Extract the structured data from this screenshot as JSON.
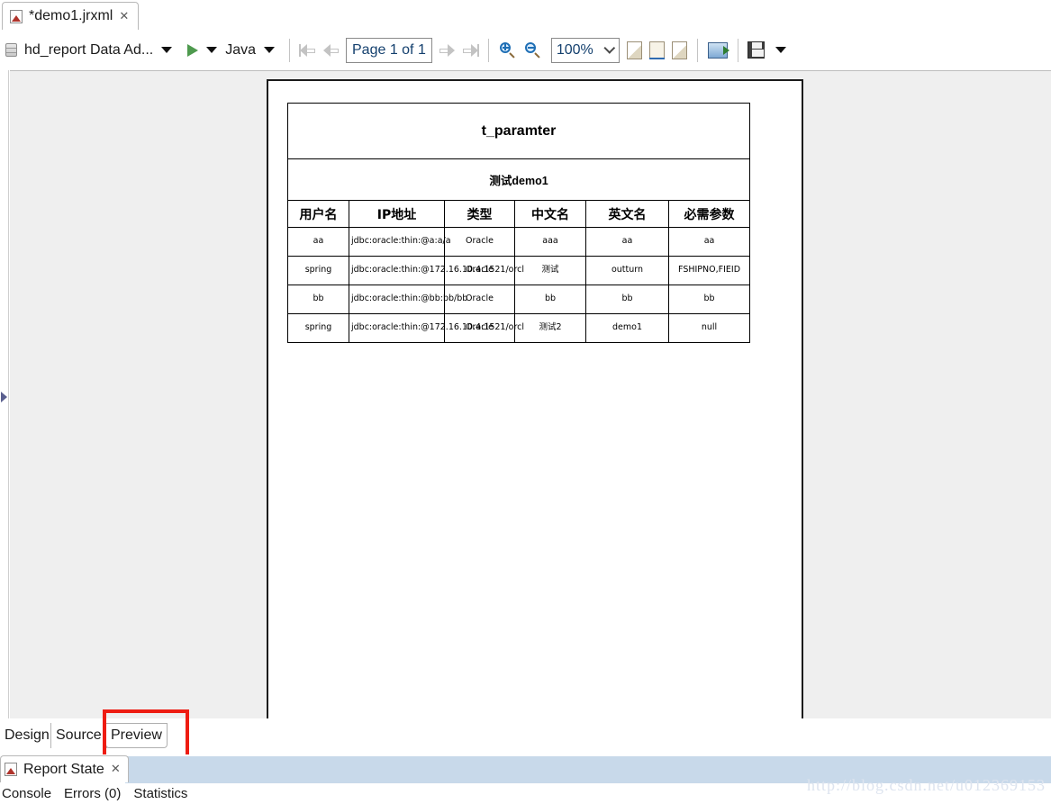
{
  "editor_tab": {
    "title": "*demo1.jrxml",
    "close_label": "✕",
    "icon": "jasper-report-file-icon"
  },
  "toolbar": {
    "datasource_label": "hd_report Data Ad...",
    "datasource_icon": "database-icon",
    "datasource_caret": "▼",
    "run_icon": "run-play-icon",
    "run_caret": "▼",
    "language_label": "Java",
    "language_caret": "▼",
    "nav_first": "first-page-icon",
    "nav_prev": "previous-page-icon",
    "page_field_value": "Page 1 of 1",
    "nav_next": "next-page-icon",
    "nav_last": "last-page-icon",
    "zoom_in_icon": "zoom-in-icon",
    "zoom_out_icon": "zoom-out-icon",
    "zoom_value": "100%",
    "zoom_chevron": "chevron-down-icon",
    "fit_page_icon": "fit-page-icon",
    "fit_width_icon": "fit-width-icon",
    "actual_size_icon": "actual-size-icon",
    "export_icon": "export-icon",
    "save_icon": "save-icon",
    "save_caret": "▼"
  },
  "report": {
    "title": "t_paramter",
    "subtitle": "测试demo1",
    "columns": [
      "用户名",
      "IP地址",
      "类型",
      "中文名",
      "英文名",
      "必需参数"
    ],
    "rows": [
      [
        "aa",
        "jdbc:oracle:thin:@a:a/a",
        "Oracle",
        "aaa",
        "aa",
        "aa"
      ],
      [
        "spring",
        "jdbc:oracle:thin:@172.16.10.4:1521/orcl",
        "Oracle",
        "测试",
        "outturn",
        "FSHIPNO,FIEID"
      ],
      [
        "bb",
        "jdbc:oracle:thin:@bb:bb/bb",
        "Oracle",
        "bb",
        "bb",
        "bb"
      ],
      [
        "spring",
        "jdbc:oracle:thin:@172.16.10.4:1521/orcl",
        "Oracle",
        "测试2",
        "demo1",
        "null"
      ]
    ]
  },
  "editor_bottom_tabs": {
    "design": "Design",
    "source": "Source",
    "preview": "Preview",
    "highlight_color": "#ee1c12"
  },
  "view_tab": {
    "title": "Report State",
    "close_label": "✕",
    "icon": "jasper-report-state-icon",
    "strip_color": "#c8d9ea"
  },
  "bottom_bar": {
    "console": "Console",
    "errors": "Errors (0)",
    "statistics": "Statistics"
  },
  "watermark": {
    "text": "http://blog.csdn.net/u012369153"
  },
  "left_panel": {
    "expand_icon": "expand-panel-arrow-icon"
  }
}
